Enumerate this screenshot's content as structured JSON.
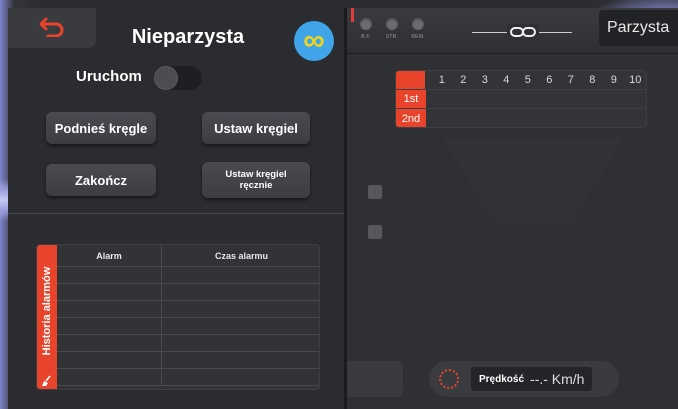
{
  "header": {
    "title": "Nieparzysta",
    "mode_right": "Parzysta"
  },
  "controls": {
    "run_label": "Uruchom",
    "run_toggle_on": false,
    "raise_pins": "Podnieś kręgle",
    "set_pin": "Ustaw kręgiel",
    "finish": "Zakończ",
    "set_pin_manual_line1": "Ustaw kręgiel",
    "set_pin_manual_line2": "ręcznie"
  },
  "alarm_history": {
    "side_title": "Historia alarmów",
    "columns": [
      "Alarm",
      "Czas alarmu"
    ],
    "rows": []
  },
  "board": {
    "indicators": [
      {
        "label": "B.F."
      },
      {
        "label": "STR."
      },
      {
        "label": "REM."
      }
    ],
    "frames": [
      "1",
      "2",
      "3",
      "4",
      "5",
      "6",
      "7",
      "8",
      "9",
      "10"
    ],
    "rounds": [
      "1st",
      "2nd"
    ]
  },
  "speed": {
    "label": "Prędkość",
    "value": "--.- Km/h"
  },
  "colors": {
    "accent": "#e8442c",
    "info": "#3fa4e8",
    "infinity": "#f2d41a"
  }
}
